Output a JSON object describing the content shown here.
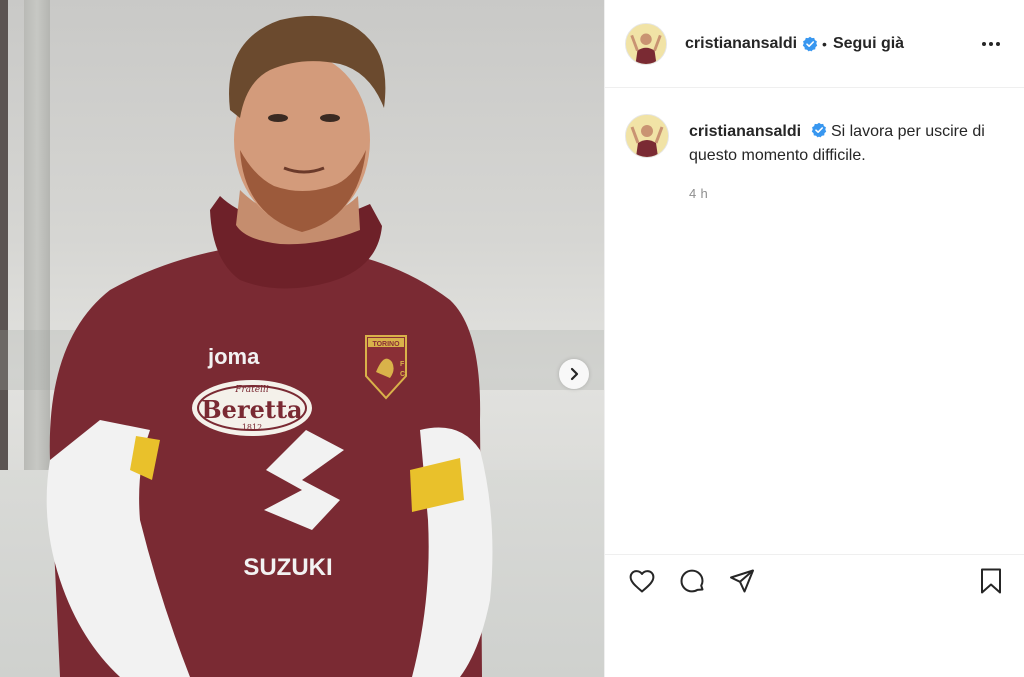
{
  "post": {
    "author": {
      "username": "cristianansaldi",
      "verified": true,
      "avatar_icon": "profile-avatar"
    },
    "follow_status": "Segui già",
    "separator": "•",
    "caption": {
      "username": "cristianansaldi",
      "text": "Si lavora per uscire di questo momento difficile.",
      "time": "4 h"
    },
    "media": {
      "subject": "footballer in maroon training top",
      "jersey_texts": [
        "Joma",
        "Fratelli",
        "Beretta",
        "1812",
        "SUZUKI",
        "TORINO",
        "F",
        "C"
      ],
      "carousel_next_icon": "chevron-right-icon"
    },
    "actions": [
      {
        "name": "like",
        "icon": "heart-icon"
      },
      {
        "name": "comment",
        "icon": "comment-icon"
      },
      {
        "name": "share",
        "icon": "send-icon"
      },
      {
        "name": "save",
        "icon": "bookmark-icon"
      }
    ],
    "colors": {
      "verified": "#3897f0",
      "text": "#262626",
      "secondary": "#8e8e8e",
      "border": "#efefef",
      "jersey": "#7a2a33"
    }
  }
}
